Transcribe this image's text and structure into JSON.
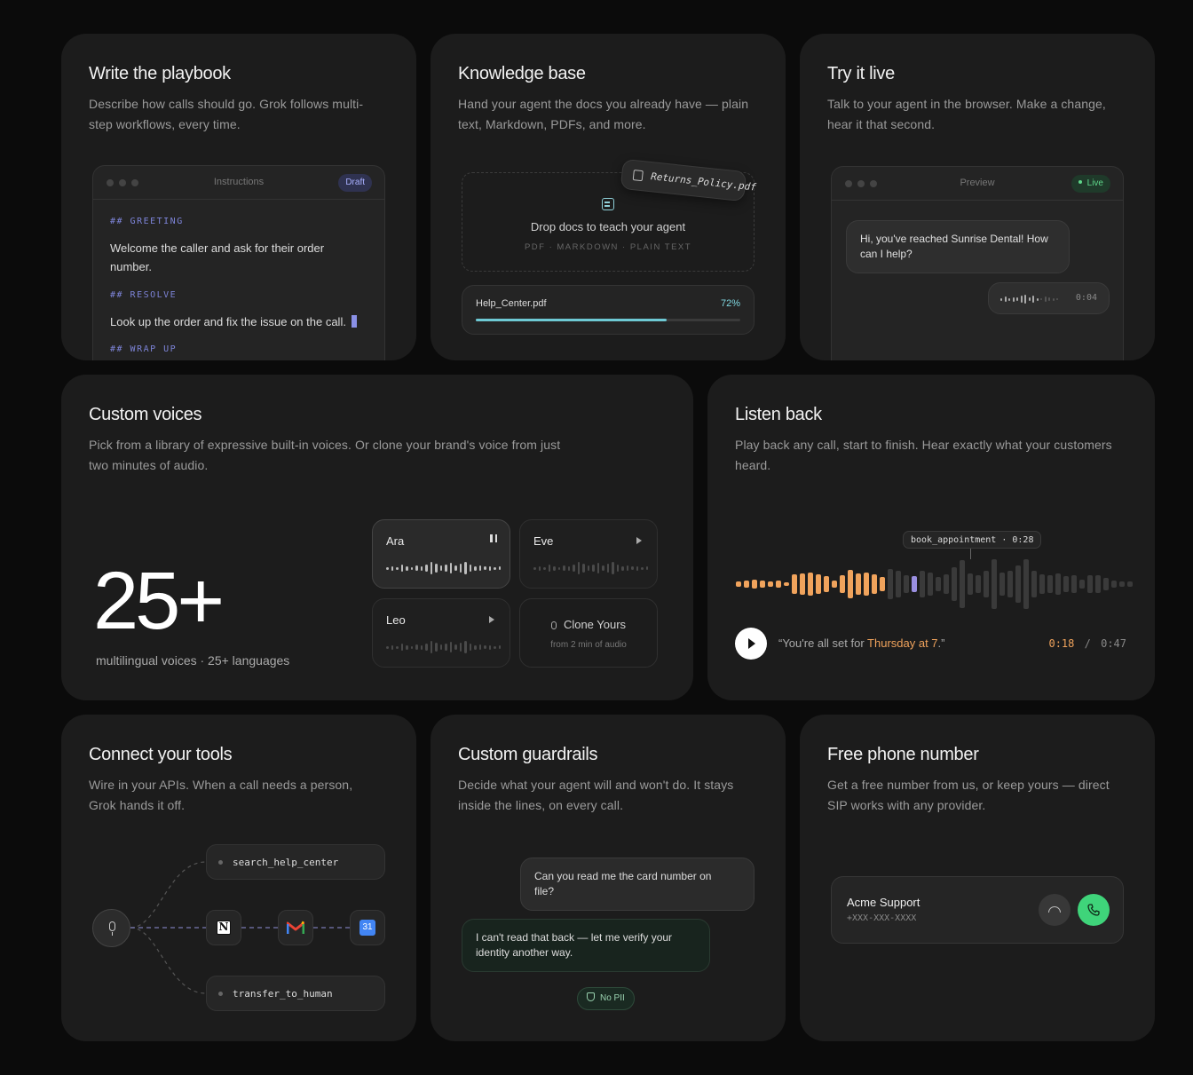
{
  "playbook": {
    "title": "Write the playbook",
    "desc_line1": "Describe how calls should go. Grok follows multi-",
    "desc_line2": "step workflows, every time.",
    "window_title": "Instructions",
    "badge": "Draft",
    "h1": "## GREETING",
    "t1_line1": "Welcome the caller and ask for their order",
    "t1_line2": "number.",
    "h2": "## RESOLVE",
    "t2": "Look up the order and fix the issue on the call.",
    "h3": "## WRAP UP"
  },
  "knowledge": {
    "title": "Knowledge base",
    "desc_line1": "Hand your agent the docs you already have — plain",
    "desc_line2": "text, Markdown, PDFs, and more.",
    "floating_file": "Returns_Policy.pdf",
    "drop_text": "Drop docs to teach your agent",
    "formats": "PDF · MARKDOWN · PLAIN TEXT",
    "upload_file": "Help_Center.pdf",
    "upload_percent_label": "72%",
    "upload_progress": 0.72
  },
  "tryit": {
    "title": "Try it live",
    "desc_line1": "Talk to your agent in the browser. Make a change,",
    "desc_line2": "hear it that second.",
    "window_title": "Preview",
    "badge": "Live",
    "bubble_line1": "Hi, you've reached Sunrise Dental! How",
    "bubble_line2": "can I help?",
    "audio_time": "0:04"
  },
  "voices": {
    "title": "Custom voices",
    "desc_line1": "Pick from a library of expressive built-in voices. Or clone your brand's voice from just",
    "desc_line2": "two minutes of audio.",
    "big_number": "25+",
    "caption": "multilingual voices · 25+ languages",
    "items": [
      {
        "name": "Ara",
        "icon": "pause-icon"
      },
      {
        "name": "Eve",
        "icon": "play-icon"
      },
      {
        "name": "Leo",
        "icon": "play-icon"
      }
    ],
    "clone_title": "Clone Yours",
    "clone_sub": "from 2 min of audio"
  },
  "listen": {
    "title": "Listen back",
    "desc_line1": "Play back any call, start to finish. Hear exactly what your customers",
    "desc_line2": "heard.",
    "marker": "book_appointment · 0:28",
    "quote_prefix": "“You're all set for ",
    "quote_highlight": "Thursday at 7",
    "quote_suffix": ".”",
    "current_time": "0:18",
    "separator": "/",
    "total_time": "0:47",
    "accent": "#f0a35c",
    "playback_progress": 0.383
  },
  "tools": {
    "title": "Connect your tools",
    "desc_line1": "Wire in your APIs. When a call needs a person,",
    "desc_line2": "Grok hands it off.",
    "fn_top": "search_help_center",
    "fn_bottom": "transfer_to_human",
    "calendar_day": "31"
  },
  "guardrails": {
    "title": "Custom guardrails",
    "desc_line1": "Decide what your agent will and won't do. It stays",
    "desc_line2": "inside the lines, on every call.",
    "user_line1": "Can you read me the card number on",
    "user_line2": "file?",
    "agent_line1": "I can't read that back — let me verify your",
    "agent_line2": "identity another way.",
    "badge": "No PII"
  },
  "phone": {
    "title": "Free phone number",
    "desc_line1": "Get a free number from us, or keep yours — direct",
    "desc_line2": "SIP works with any provider.",
    "name": "Acme Support",
    "number": "+XXX-XXX-XXXX",
    "accept_color": "#3fd47a"
  }
}
